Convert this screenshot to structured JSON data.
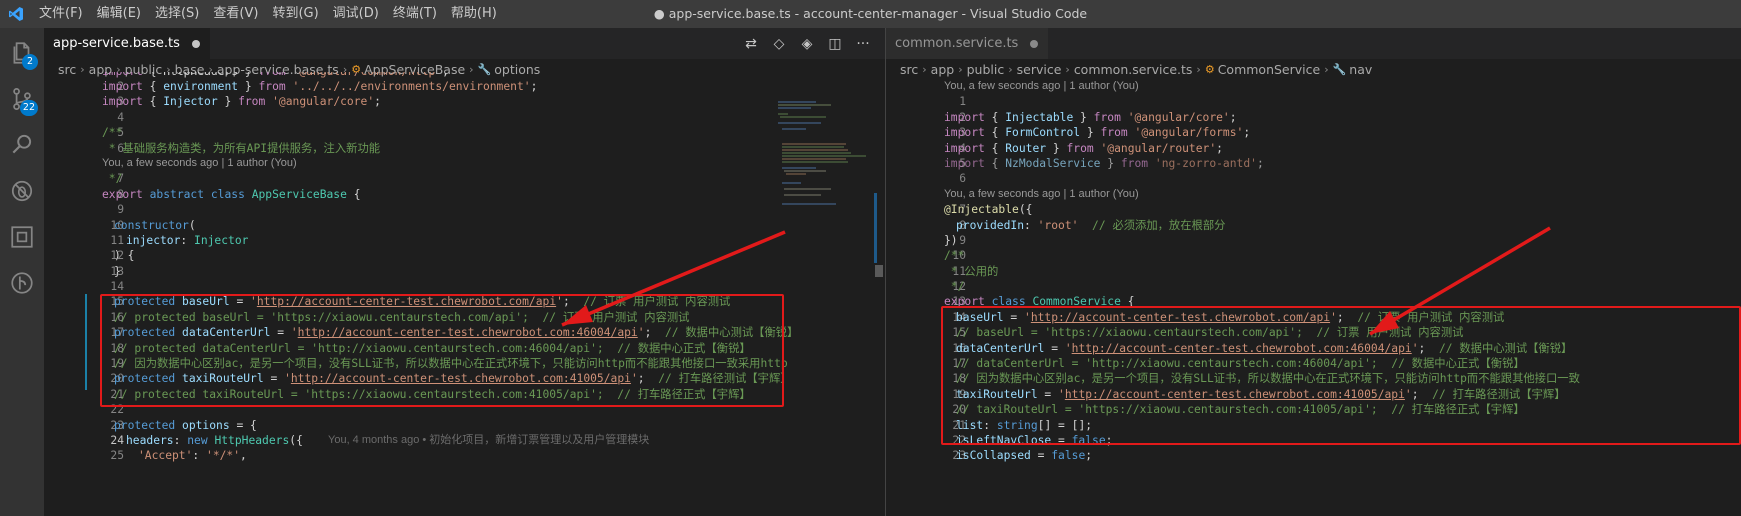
{
  "titlebar": {
    "menu": [
      "文件(F)",
      "编辑(E)",
      "选择(S)",
      "查看(V)",
      "转到(G)",
      "调试(D)",
      "终端(T)",
      "帮助(H)"
    ],
    "title": "● app-service.base.ts - account-center-manager - Visual Studio Code"
  },
  "activity": {
    "source_control_badge": "2",
    "git_badge": "22"
  },
  "left": {
    "tab": "app-service.base.ts",
    "breadcrumb": [
      "src",
      "app",
      "public",
      "base",
      "app-service.base.ts",
      "AppServiceBase",
      "options"
    ],
    "blame_lens_1": "You, a few seconds ago | 1 author (You)",
    "ghost_blame": "You, 4 months ago • 初始化项目，新增订票管理以及用户管理模块"
  },
  "right": {
    "tab": "common.service.ts",
    "breadcrumb": [
      "src",
      "app",
      "public",
      "service",
      "common.service.ts",
      "CommonService",
      "nav"
    ],
    "blame_lens_1": "You, a few seconds ago | 1 author (You)",
    "blame_lens_2": "You, a few seconds ago | 1 author (You)"
  },
  "colors": {
    "accent": "#007acc",
    "highlight_box": "#e21a1a"
  }
}
